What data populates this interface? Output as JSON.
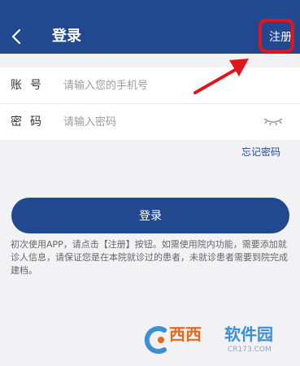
{
  "header": {
    "title": "登录",
    "register_label": "注册",
    "back_icon": "chevron-left-icon",
    "background": "#22498f"
  },
  "form": {
    "account": {
      "label": "账号",
      "placeholder": "请输入您的手机号",
      "value": ""
    },
    "password": {
      "label": "密码",
      "placeholder": "请输入密码",
      "value": "",
      "toggle_icon": "eye-closed-icon"
    }
  },
  "forgot_password_label": "忘记密码",
  "login_button_label": "登录",
  "notice": "初次使用APP，请点击【注册】按钮。如需使用院内功能，需要添加就诊人信息，请保证您是在本院就诊过的患者，未就诊患者需要到院完成建档。",
  "annotation": {
    "highlight_color": "#e2141c"
  },
  "watermark": {
    "text_main": "西西",
    "text_secondary": "软件园",
    "subtext": "CR173.COM"
  }
}
